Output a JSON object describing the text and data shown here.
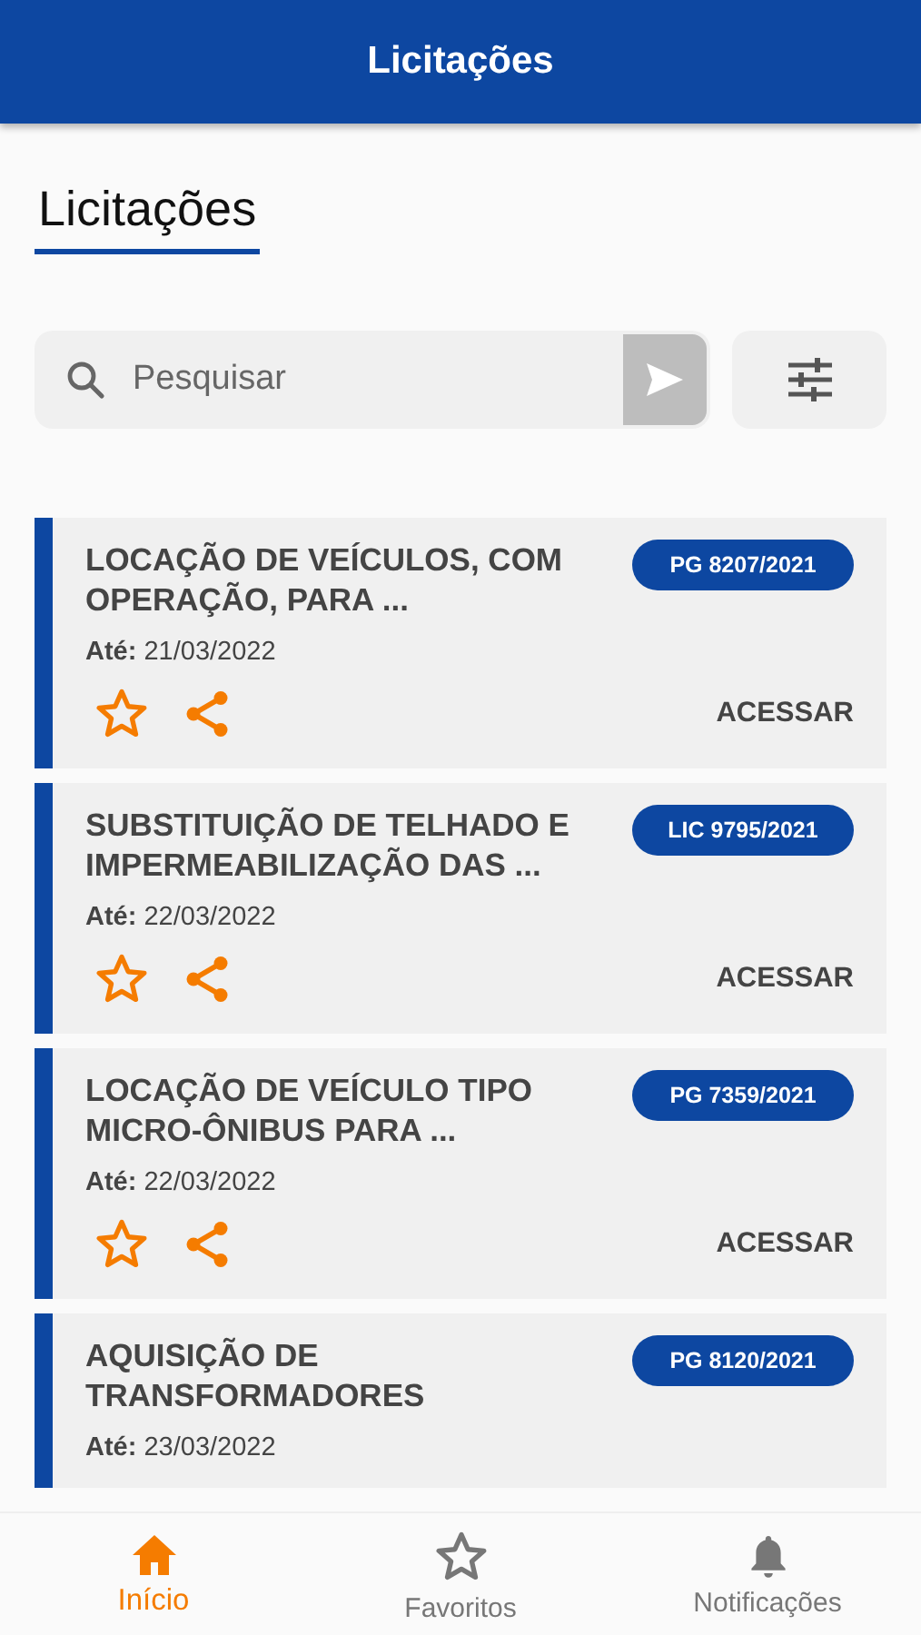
{
  "app_bar": {
    "title": "Licitações"
  },
  "heading": "Licitações",
  "search": {
    "placeholder": "Pesquisar"
  },
  "cards": [
    {
      "title": "LOCAÇÃO DE VEÍCULOS, COM OPERAÇÃO, PARA ...",
      "code": "PG 8207/2021",
      "due": "**Até:** 21/03/2022",
      "favorite": false,
      "action": "ACESSAR"
    },
    {
      "title": "SUBSTITUIÇÃO DE TELHADO E IMPERMEABILIZAÇÃO DAS ...",
      "code": "LIC 9795/2021",
      "due": "**Até:** 22/03/2022",
      "favorite": false,
      "action": "ACESSAR"
    },
    {
      "title": "LOCAÇÃO DE VEÍCULO TIPO MICRO-ÔNIBUS PARA ...",
      "code": "PG 7359/2021",
      "due": "**Até:** 22/03/2022",
      "favorite": false,
      "action": "ACESSAR"
    },
    {
      "title": "AQUISIÇÃO DE TRANSFORMADORES",
      "code": "PG 8120/2021",
      "due": "**Até:** 23/03/2022"
    }
  ],
  "bottom_nav": [
    {
      "kind": "home",
      "label": "Início",
      "selected": true
    },
    {
      "kind": "star",
      "label": "Favoritos",
      "selected": false
    },
    {
      "kind": "bell",
      "label": "Notificações",
      "selected": false
    }
  ]
}
